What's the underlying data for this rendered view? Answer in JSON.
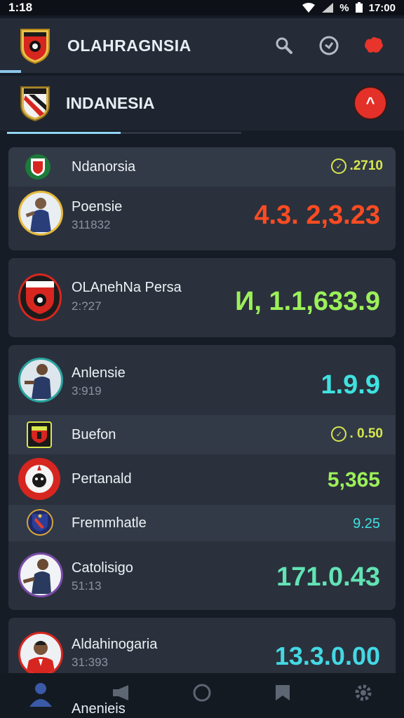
{
  "status": {
    "time_left": "1:18",
    "time_right": "17:00",
    "battery_text": "%"
  },
  "header": {
    "title": "OLAHRAGNSIA"
  },
  "subheader": {
    "title": "INDANESIA"
  },
  "colors": {
    "accent": "#8fd5f1",
    "red": "#e33029",
    "orange_value": "#ff4b22",
    "green_value": "#9cf05a",
    "teal_value": "#3fe2e0",
    "yellow": "#d7e74c"
  },
  "items": {
    "r1": {
      "name": "Ndanorsia",
      "chip": ".2710"
    },
    "r2": {
      "name": "Poensie",
      "sub": "311832",
      "value": "4.3. 2,3.23"
    },
    "r3": {
      "name": "OLAnehNa Persa",
      "sub": "2:?27",
      "value": "И, 1.1,633.9"
    },
    "r4": {
      "name": "Anlensie",
      "sub": "3:919",
      "value": "1.9.9"
    },
    "r5": {
      "name": "Buefon",
      "chip": ". 0.50"
    },
    "r6": {
      "name": "Pertanald",
      "value": "5,365"
    },
    "r7": {
      "name": "Fremmhatle",
      "value": "9.25"
    },
    "r8": {
      "name": "Catolisigo",
      "sub": "51:13",
      "value": "171.0.43"
    },
    "r9": {
      "name": "Aldahinogaria",
      "sub": "31:393",
      "value": "13.3.0.00"
    }
  },
  "bottom_nav": {
    "label": "Anenieis",
    "icons": [
      "person-icon",
      "megaphone-icon",
      "circle-icon",
      "bookmark-icon",
      "gear-icon"
    ]
  }
}
